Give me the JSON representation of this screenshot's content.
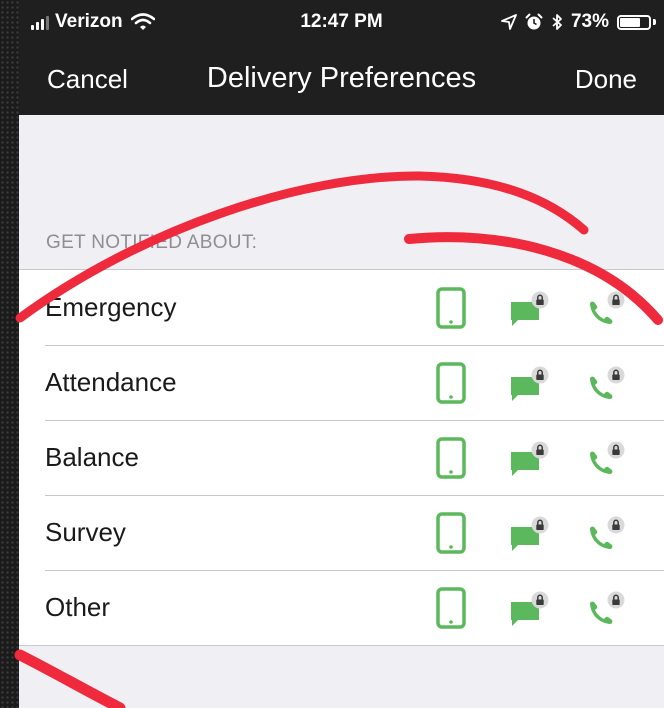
{
  "status_bar": {
    "carrier": "Verizon",
    "time": "12:47 PM",
    "battery_percent": "73%",
    "battery_level": 0.73,
    "icons": [
      "signal-icon",
      "wifi-icon",
      "location-icon",
      "alarm-icon",
      "bluetooth-icon",
      "battery-icon"
    ]
  },
  "nav": {
    "cancel_label": "Cancel",
    "title": "Delivery Preferences",
    "done_label": "Done"
  },
  "section": {
    "header": "GET NOTIFIED ABOUT:",
    "rows": [
      {
        "label": "Emergency"
      },
      {
        "label": "Attendance"
      },
      {
        "label": "Balance"
      },
      {
        "label": "Survey"
      },
      {
        "label": "Other"
      }
    ],
    "channel_icons": [
      "mobile-phone-icon",
      "sms-message-icon",
      "voice-call-icon",
      "lock-icon"
    ]
  },
  "colors": {
    "accent_green": "#5cb85c",
    "nav_background": "#1f1f1f",
    "annotation_red": "#ee2a3c",
    "page_background": "#efeff4"
  }
}
